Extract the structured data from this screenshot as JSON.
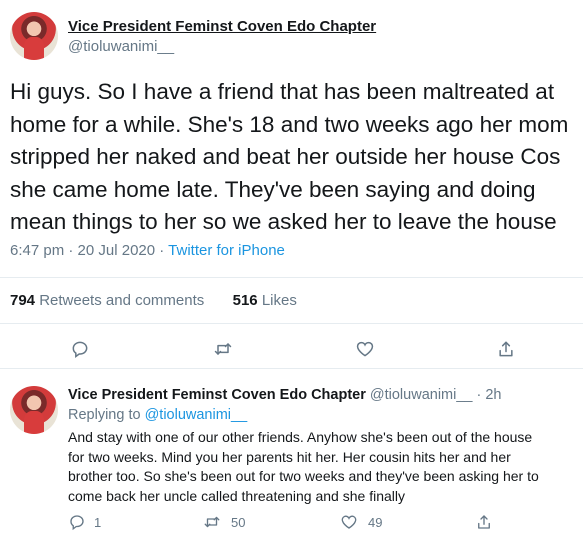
{
  "main_tweet": {
    "display_name": "Vice President Feminst Coven Edo Chapter",
    "handle": "@tioluwanimi__",
    "lines": [
      "Hi guys. So I have a friend that has been maltreated at",
      "home for a while. She's 18 and two weeks ago her mom",
      "stripped her naked and beat her outside her house Cos",
      "she came home late. They've been saying and doing",
      "mean things to her so we asked her to leave the house"
    ],
    "time": "6:47 pm · 20 Jul 2020 · ",
    "source": "Twitter for iPhone",
    "retweets_count": "794",
    "retweets_label": " Retweets and comments",
    "likes_count": "516",
    "likes_label": " Likes"
  },
  "reply_tweet": {
    "display_name": "Vice President Feminst Coven Edo Chapter",
    "handle_time": " @tioluwanimi__ · 2h",
    "replying_label": "Replying to ",
    "replying_handle": "@tioluwanimi__",
    "lines": [
      "And stay with one of our other friends. Anyhow she's been out of the house",
      "for two weeks. Mind you her parents hit her. Her cousin hits her and her",
      "brother too. So she's been out for two weeks and they've been asking her to",
      "come back her uncle called threatening and she finally"
    ],
    "reply_count": "1",
    "retweet_count": "50",
    "like_count": "49"
  },
  "icons": [
    "comment-icon",
    "retweet-icon",
    "heart-icon",
    "share-icon"
  ],
  "colors": {
    "link": "#1b95e0",
    "muted": "#657786",
    "text": "#14171a",
    "divider": "#e6ecf0"
  }
}
